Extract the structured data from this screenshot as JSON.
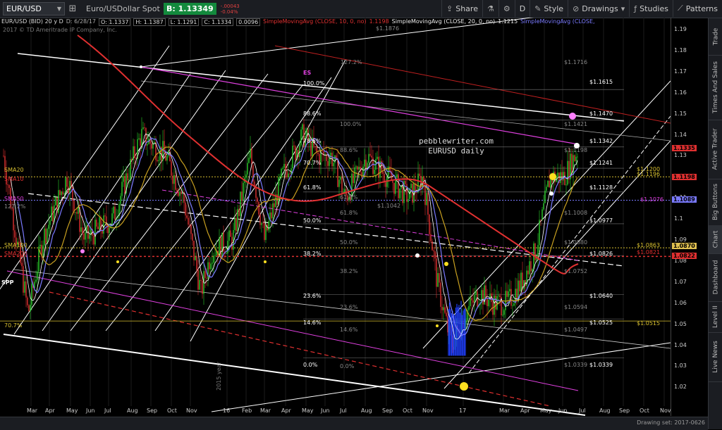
{
  "toolbar": {
    "symbol": "EUR/USD",
    "description": "Euro/USDollar Spot",
    "bid": "B: 1.13349",
    "change_abs": "-.00043",
    "change_pct": "-0.04%",
    "share_label": "Share",
    "interval": "D",
    "style_label": "Style",
    "drawings_label": "Drawings",
    "studies_label": "Studies",
    "patterns_label": "Patterns"
  },
  "legend": {
    "title": "EUR/USD (BID) 20 y D",
    "date": "D: 6/28/17",
    "open": "O: 1.1337",
    "high": "H: 1.1387",
    "low": "L: 1.1291",
    "close": "C: 1.1334",
    "change": "0.0096",
    "sma10": "SimpleMovingAvg (CLOSE, 10, 0, no)",
    "sma10_value": "1.1198",
    "sma20": "SimpleMovingAvg (CLOSE, 20, 0, no)",
    "sma20_value": "1.1215",
    "sma40": "SimpleMovingAvg (CLOSE,"
  },
  "copyright": "2017 © TD Ameritrade IP Company, Inc.",
  "watermark": [
    "pebblewriter.com",
    "EURUSD daily"
  ],
  "price_axis": {
    "ticks": [
      "1.19",
      "1.18",
      "1.17",
      "1.16",
      "1.15",
      "1.14",
      "1.13",
      "1.12",
      "1.11",
      "1.1",
      "1.09",
      "1.08",
      "1.07",
      "1.06",
      "1.05",
      "1.04",
      "1.03",
      "1.02"
    ],
    "badges": [
      {
        "text": "1.1335",
        "color": "#e03030"
      },
      {
        "text": "1.1198",
        "color": "#e03030"
      },
      {
        "text": "1.1089",
        "color": "#7a7aff"
      },
      {
        "text": "1.0870",
        "color": "#e0c050"
      },
      {
        "text": "1.0822",
        "color": "#e03030"
      }
    ]
  },
  "time_axis": [
    "Mar",
    "Apr",
    "May",
    "Jun",
    "Jul",
    "Aug",
    "Sep",
    "Oct",
    "Nov",
    "16",
    "Feb",
    "Mar",
    "Apr",
    "May",
    "Jun",
    "Jul",
    "Aug",
    "Sep",
    "Oct",
    "Nov",
    "17",
    "Mar",
    "Apr",
    "May",
    "Jun",
    "Jul",
    "Aug",
    "Sep",
    "Oct",
    "Nov"
  ],
  "annotations": {
    "sma_labels": [
      "SMA20",
      "SMA10",
      "SMA50",
      "SMA100",
      "SMA200"
    ],
    "pct_127_left": "127.2%",
    "pct_70_left": "70.7%",
    "spp": "SPP",
    "es": "ES",
    "fib_upper": [
      "127.2%",
      "100.0%",
      "88.6%",
      "78.6%",
      "70.7%",
      "61.8%",
      "50.0%",
      "38.2%",
      "23.6%",
      "14.6%",
      "0.0%"
    ],
    "fib_lower": [
      "100.0%",
      "88.6%",
      "61.8%",
      "50.0%",
      "38.2%",
      "23.6%",
      "14.6%",
      "0.0%"
    ],
    "fib_lower_extra": "61.8%",
    "right_prices_white": [
      "$1.1615",
      "$1.1470",
      "$1.1342",
      "$1.1241",
      "$1.1128",
      "$1.0977",
      "$1.0826",
      "$1.0640",
      "$1.0525",
      "$1.0339"
    ],
    "right_prices_grey": [
      "$1.1876",
      "$1.1716",
      "$1.1421",
      "$1.1198",
      "$1.1042",
      "$1.1008",
      "$1.0880",
      "$1.0752",
      "$1.0594",
      "$1.0497",
      "$1.0339"
    ],
    "yellow_prices": [
      "$1.1200",
      "$1.1196",
      "$1.1076",
      "$1.0863",
      "$1.0821",
      "$1.0515"
    ],
    "year_label": "2015 year"
  },
  "sidebar": [
    "Trade",
    "Times And Sales",
    "Active Trader",
    "Big Buttons",
    "Chart",
    "Dashboard",
    "Level II",
    "Live News"
  ],
  "status": {
    "drawing_set": "Drawing set: 2017-0626"
  },
  "colors": {
    "bull": "#2bd12b",
    "bear": "#e03030",
    "sma10": "#e03030",
    "sma20": "#ffffff",
    "sma40": "#7a7aff",
    "sma100": "#c8a020",
    "magenta": "#e040e0",
    "fib_white": "#ffffff",
    "fib_grey": "#888888"
  }
}
